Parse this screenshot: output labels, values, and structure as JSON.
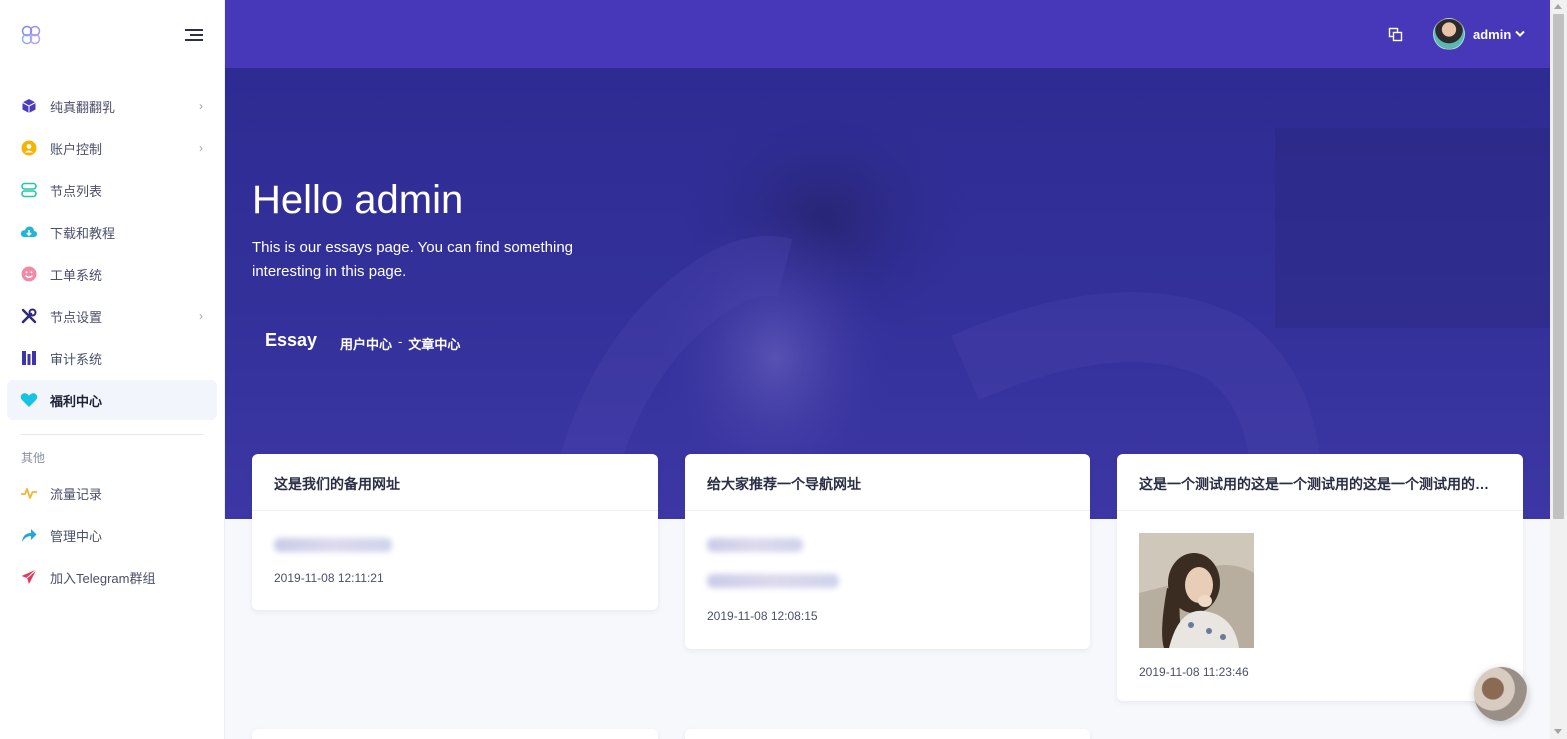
{
  "sidebar": {
    "items": [
      {
        "label": "纯真翻翻乳",
        "icon": "cube-icon",
        "color": "#4a3bc2",
        "chevron": true
      },
      {
        "label": "账户控制",
        "icon": "user-circle-icon",
        "color": "#f5b400",
        "chevron": true
      },
      {
        "label": "节点列表",
        "icon": "node-list-icon",
        "color": "#20c9a6",
        "chevron": false
      },
      {
        "label": "下载和教程",
        "icon": "cloud-download-icon",
        "color": "#21b6d9",
        "chevron": false
      },
      {
        "label": "工单系统",
        "icon": "smile-icon",
        "color": "#f08aa6",
        "chevron": false
      },
      {
        "label": "节点设置",
        "icon": "tools-icon",
        "color": "#2d2a7a",
        "chevron": true
      },
      {
        "label": "审计系统",
        "icon": "audit-bars-icon",
        "color": "#3d35b0",
        "chevron": false
      },
      {
        "label": "福利中心",
        "icon": "heart-icon",
        "color": "#16c3e3",
        "chevron": false
      }
    ],
    "section_label": "其他",
    "other_items": [
      {
        "label": "流量记录",
        "icon": "activity-icon",
        "color": "#f2b632"
      },
      {
        "label": "管理中心",
        "icon": "share-arrow-icon",
        "color": "#22a6e0"
      },
      {
        "label": "加入Telegram群组",
        "icon": "paper-plane-icon",
        "color": "#e8375a"
      }
    ]
  },
  "header": {
    "username": "admin",
    "accent": "#4737b9"
  },
  "hero": {
    "title": "Hello admin",
    "subtitle": "This is our essays page. You can find something interesting in this page.",
    "page_label": "Essay",
    "breadcrumbs": [
      "用户中心",
      "文章中心"
    ],
    "breadcrumb_sep": "-"
  },
  "cards": [
    {
      "title": "这是我们的备用网址",
      "time": "2019-11-08 12:11:21"
    },
    {
      "title": "给大家推荐一个导航网址",
      "time": "2019-11-08 12:08:15"
    },
    {
      "title": "这是一个测试用的这是一个测试用的这是一个测试用的这是一个测试用的",
      "time": "2019-11-08 11:23:46"
    }
  ]
}
